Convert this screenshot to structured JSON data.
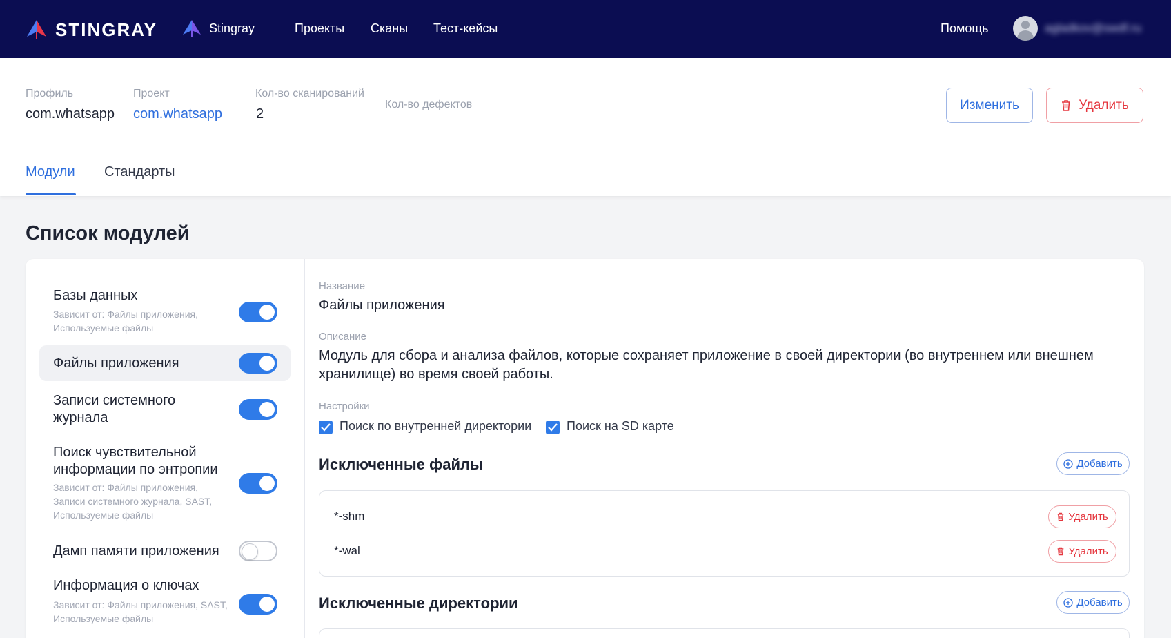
{
  "navbar": {
    "brand": "STINGRAY",
    "organization": "Stingray",
    "links": [
      "Проекты",
      "Сканы",
      "Тест-кейсы"
    ],
    "help": "Помощь",
    "user_email": "agladkov@swdf.ru"
  },
  "header": {
    "profile_label": "Профиль",
    "profile_value": "com.whatsapp",
    "project_label": "Проект",
    "project_value": "com.whatsapp",
    "scans_label": "Кол-во сканирований",
    "scans_value": "2",
    "defects_label": "Кол-во дефектов",
    "edit_button": "Изменить",
    "delete_button": "Удалить"
  },
  "tabs": [
    "Модули",
    "Стандарты"
  ],
  "page_title": "Список модулей",
  "modules": [
    {
      "name": "Базы данных",
      "dep": "Зависит от:  Файлы приложения, Используемые файлы",
      "enabled": true
    },
    {
      "name": "Файлы приложения",
      "dep": "",
      "enabled": true
    },
    {
      "name": "Записи системного журнала",
      "dep": "",
      "enabled": true
    },
    {
      "name": "Поиск чувствительной информации по энтропии",
      "dep": "Зависит от:  Файлы приложения, Записи системного журнала, SAST, Используемые файлы",
      "enabled": true
    },
    {
      "name": "Дамп памяти приложения",
      "dep": "",
      "enabled": false
    },
    {
      "name": "Информация о ключах",
      "dep": "Зависит от:  Файлы приложения, SAST, Используемые файлы",
      "enabled": true
    }
  ],
  "detail": {
    "name_label": "Название",
    "name_value": "Файлы приложения",
    "description_label": "Описание",
    "description_value": "Модуль для сбора и анализа файлов, которые сохраняет приложение в своей директории (во внутреннем или внешнем хранилище) во время своей работы.",
    "settings_label": "Настройки",
    "setting_internal": "Поиск по внутренней директории",
    "setting_sd": "Поиск на SD карте",
    "excluded_files_title": "Исключенные файлы",
    "excluded_files": [
      "*-shm",
      "*-wal"
    ],
    "excluded_dirs_title": "Исключенные директории",
    "add_button": "Добавить",
    "delete_button": "Удалить"
  },
  "colors": {
    "navbar": "#0b0d52",
    "accent": "#2f6fde",
    "danger": "#e5363e"
  }
}
